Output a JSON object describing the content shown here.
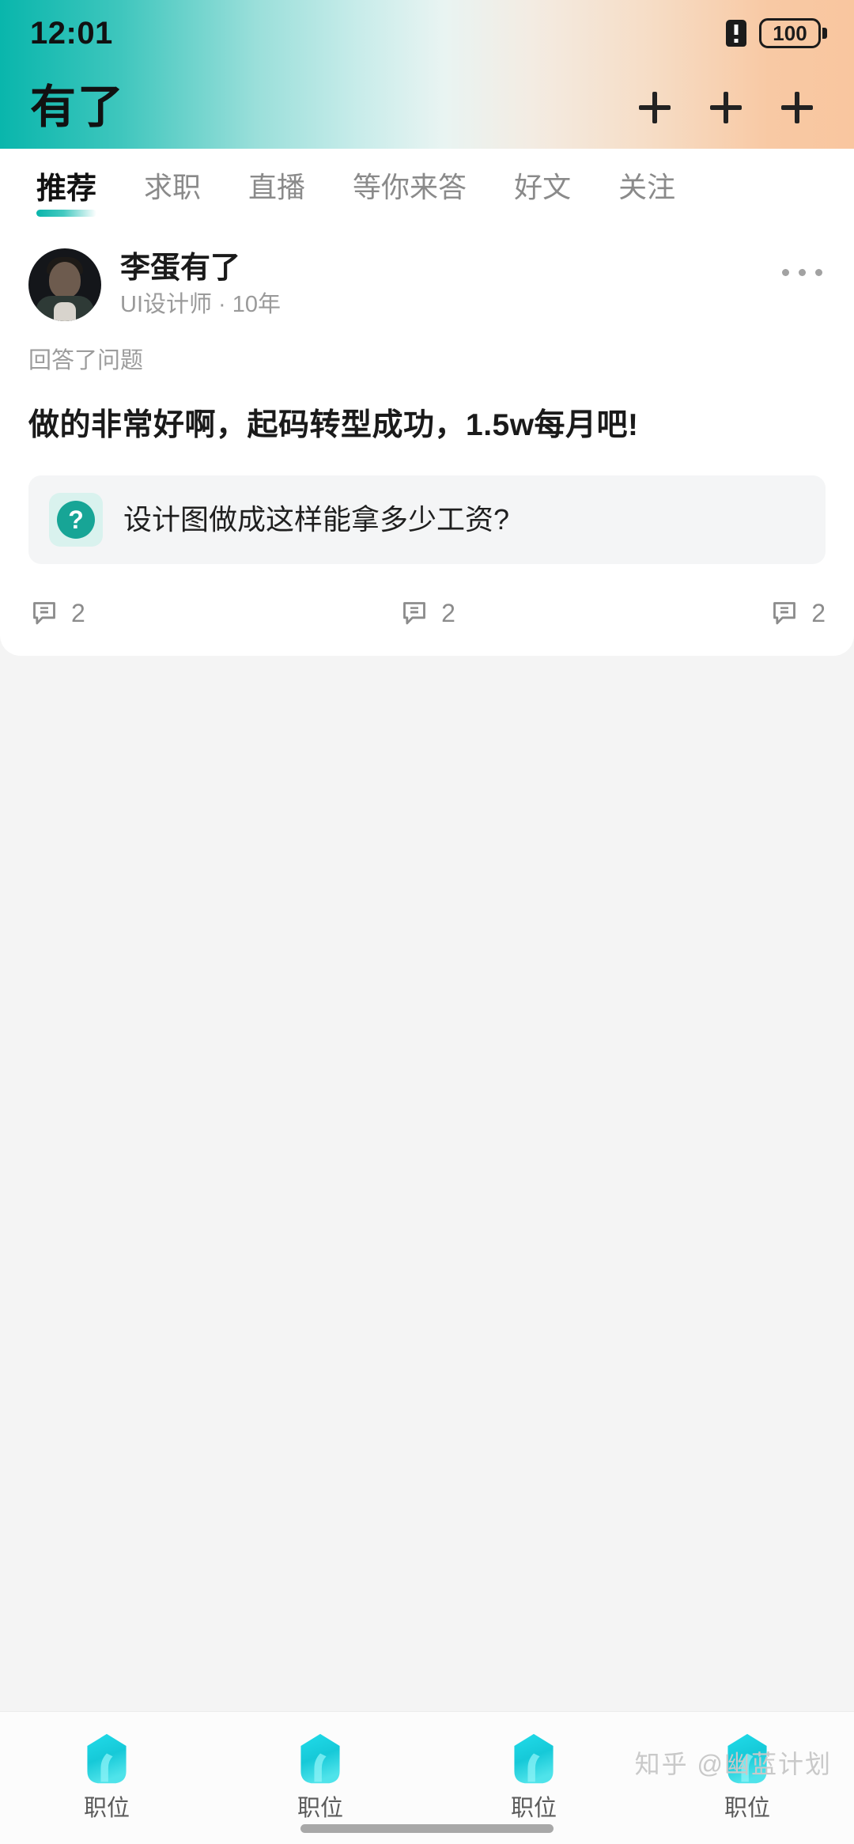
{
  "status_bar": {
    "time": "12:01",
    "battery_level": "100",
    "sim_icon": "sim-alert-icon",
    "battery_icon": "battery-icon"
  },
  "app_bar": {
    "title": "有了",
    "actions": [
      {
        "icon": "plus-icon",
        "label": "+"
      },
      {
        "icon": "plus-icon",
        "label": "+"
      },
      {
        "icon": "plus-icon",
        "label": "+"
      }
    ]
  },
  "tabs": [
    {
      "label": "推荐",
      "active": true
    },
    {
      "label": "求职",
      "active": false
    },
    {
      "label": "直播",
      "active": false
    },
    {
      "label": "等你来答",
      "active": false
    },
    {
      "label": "好文",
      "active": false
    },
    {
      "label": "关注",
      "active": false
    }
  ],
  "post": {
    "author_name": "李蛋有了",
    "author_subtitle": "UI设计师 · 10年",
    "action_label": "回答了问题",
    "body_text": "做的非常好啊，起码转型成功，1.5w每月吧!",
    "quote": {
      "icon": "question-mark-icon",
      "icon_glyph": "?",
      "title": "设计图做成这样能拿多少工资?"
    },
    "actions": [
      {
        "icon": "comment-icon",
        "count": "2"
      },
      {
        "icon": "comment-icon",
        "count": "2"
      },
      {
        "icon": "comment-icon",
        "count": "2"
      }
    ],
    "more_menu": "more-options-icon"
  },
  "bottom_nav": [
    {
      "label": "职位",
      "icon": "cube-icon"
    },
    {
      "label": "职位",
      "icon": "cube-icon"
    },
    {
      "label": "职位",
      "icon": "cube-icon"
    },
    {
      "label": "职位",
      "icon": "cube-icon"
    }
  ],
  "watermark": "知乎 @幽蓝计划",
  "colors": {
    "accent_teal": "#0ab5ab",
    "gradient_start": "#09b6ac",
    "gradient_end": "#f9c69f",
    "nav_icon": "#1fd3e0",
    "page_bg": "#f4f4f4",
    "quote_bg": "#f4f5f6"
  }
}
